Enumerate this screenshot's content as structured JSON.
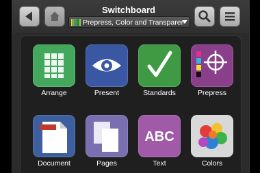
{
  "header": {
    "title": "Switchboard",
    "selector_value": "Prepress, Color and Transparency"
  },
  "icons": {
    "back": "back-arrow-icon",
    "home": "home-icon",
    "search": "search-icon",
    "menu": "hamburger-menu-icon"
  },
  "tiles": [
    {
      "label": "Arrange",
      "icon": "grid-icon",
      "color": "#43a85c"
    },
    {
      "label": "Present",
      "icon": "eye-icon",
      "color": "#3a57a3"
    },
    {
      "label": "Standards",
      "icon": "checkmark-icon",
      "color": "#3f9a43"
    },
    {
      "label": "Prepress",
      "icon": "registration-mark-icon",
      "color": "#8a3f8a"
    },
    {
      "label": "Document",
      "icon": "document-icon",
      "color": "#3d5f9f"
    },
    {
      "label": "Pages",
      "icon": "pages-icon",
      "color": "#7a6fb0"
    },
    {
      "label": "Text",
      "icon": "abc-text-icon",
      "color": "#a05aa8",
      "glyph": "ABC"
    },
    {
      "label": "Colors",
      "icon": "color-splash-icon",
      "color": "#d8d8d8"
    }
  ]
}
